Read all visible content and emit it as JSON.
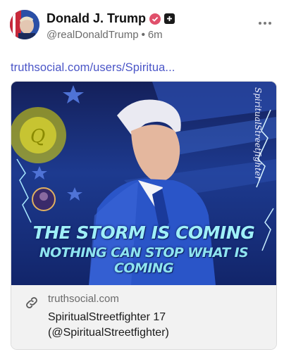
{
  "post": {
    "author_name": "Donald J. Trump",
    "handle": "@realDonaldTrump",
    "separator": "•",
    "time_ago": "6m",
    "link_text": "truthsocial.com/users/Spiritua...",
    "icons": {
      "verified": "verified-check-icon",
      "plus": "plus-badge-icon",
      "more": "more-options-icon",
      "link": "link-icon"
    }
  },
  "card": {
    "image": {
      "title": "THE STORM IS COMING",
      "subtitle": "NOTHING CAN STOP WHAT IS COMING",
      "signature": "SpiritualStreetfighter"
    },
    "domain": "truthsocial.com",
    "title_line1": "SpiritualStreetfighter 17",
    "title_line2": "(@SpiritualStreetfighter)"
  },
  "colors": {
    "link": "#4a55c7",
    "verified": "#e0506b",
    "card_footer_bg": "#f2f2f2",
    "image_blue": "#1d3a8f",
    "image_text": "#9ff0f8"
  }
}
